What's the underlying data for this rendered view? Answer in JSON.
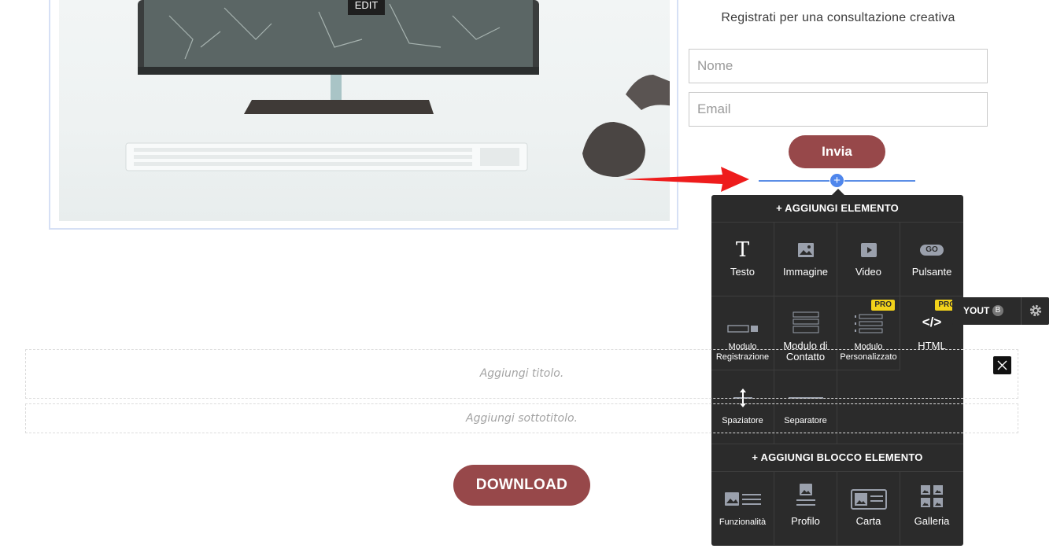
{
  "hero": {
    "edit_label": "EDIT"
  },
  "form": {
    "title": "Registrati per una consultazione creativa",
    "name_placeholder": "Nome",
    "email_placeholder": "Email",
    "submit_label": "Invia"
  },
  "panel": {
    "add_element_title": "+ AGGIUNGI ELEMENTO",
    "elements": [
      {
        "label": "Testo",
        "icon": "text-icon"
      },
      {
        "label": "Immagine",
        "icon": "image-icon"
      },
      {
        "label": "Video",
        "icon": "video-icon"
      },
      {
        "label": "Pulsante",
        "icon": "button-icon",
        "icon_text": "GO"
      },
      {
        "label": "Modulo Registrazione",
        "icon": "registration-form-icon"
      },
      {
        "label": "Modulo di Contatto",
        "icon": "contact-form-icon"
      },
      {
        "label": "Modulo Personalizzato",
        "icon": "custom-form-icon",
        "badge": "PRO"
      },
      {
        "label": "HTML",
        "icon": "code-icon",
        "icon_text": "</>",
        "badge": "PRO"
      },
      {
        "label": "Spaziatore",
        "icon": "spacer-icon"
      },
      {
        "label": "Separatore",
        "icon": "divider-icon"
      }
    ],
    "add_block_title": "+ AGGIUNGI BLOCCO ELEMENTO",
    "blocks": [
      {
        "label": "Funzionalità",
        "icon": "features-icon"
      },
      {
        "label": "Profilo",
        "icon": "profile-icon"
      },
      {
        "label": "Carta",
        "icon": "card-icon"
      },
      {
        "label": "Galleria",
        "icon": "gallery-icon"
      }
    ]
  },
  "layout_bar": {
    "label": "YOUT",
    "badge": "B"
  },
  "section": {
    "title_placeholder": "Aggiungi titolo.",
    "subtitle_placeholder": "Aggiungi sottotitolo.",
    "download_label": "DOWNLOAD"
  },
  "colors": {
    "accent": "#97484a",
    "panel": "#2b2b2b",
    "insert": "#4f86ec",
    "pro_badge": "#f2d21a"
  }
}
